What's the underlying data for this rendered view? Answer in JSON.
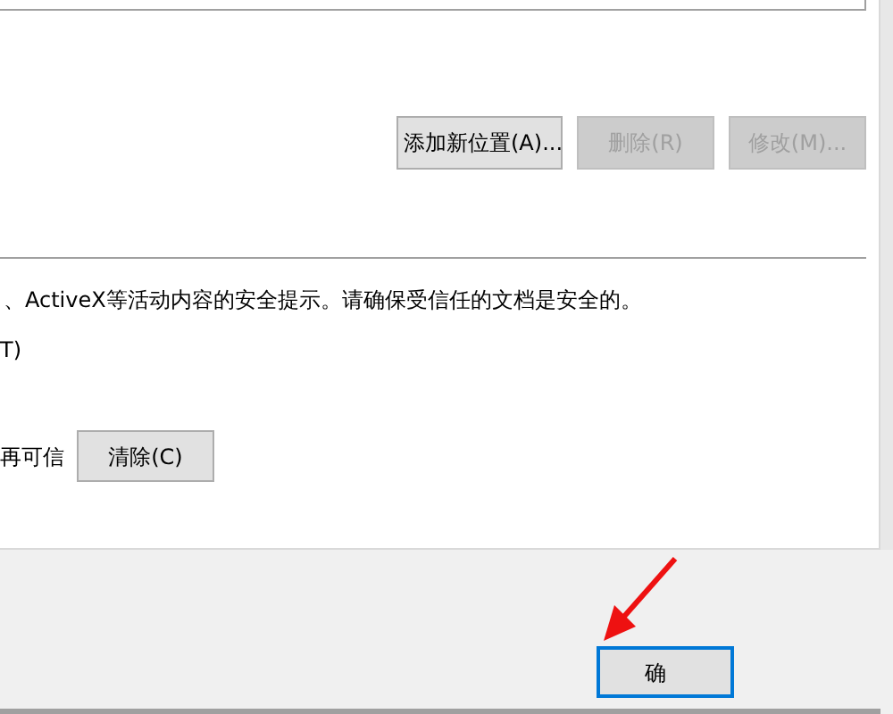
{
  "location_buttons": [
    {
      "label": "添加新位置(A)...",
      "disabled": false
    },
    {
      "label": "删除(R)",
      "disabled": true
    },
    {
      "label": "修改(M)...",
      "disabled": true
    }
  ],
  "warning_text": "、ActiveX等活动内容的安全提示。请确保受信任的文档是安全的。",
  "option_text": "T)",
  "clear_row": {
    "label": "再可信",
    "button": "清除(C)"
  },
  "footer_buttons": [
    {
      "label": "确",
      "default": true
    }
  ]
}
